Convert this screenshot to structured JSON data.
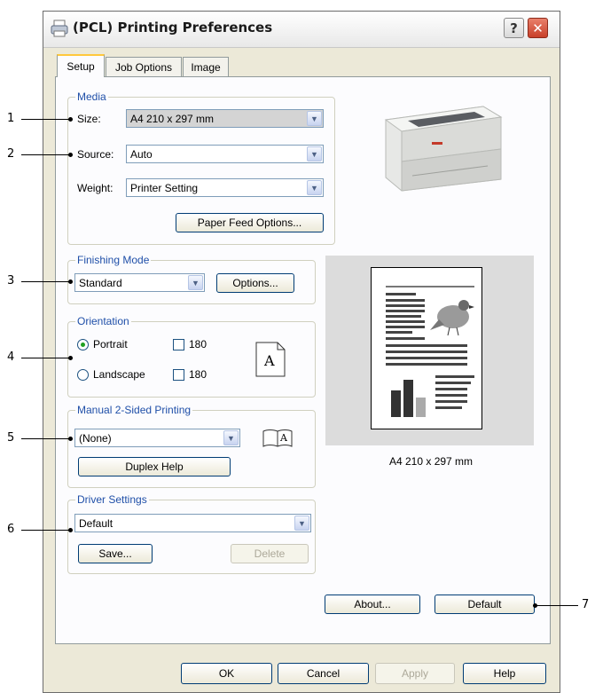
{
  "window": {
    "title": "(PCL) Printing Preferences",
    "help_glyph": "?",
    "close_glyph": "✕"
  },
  "tabs": [
    {
      "label": "Setup",
      "active": true
    },
    {
      "label": "Job Options",
      "active": false
    },
    {
      "label": "Image",
      "active": false
    }
  ],
  "media": {
    "legend": "Media",
    "size_label": "Size:",
    "size_value": "A4 210 x 297 mm",
    "source_label": "Source:",
    "source_value": "Auto",
    "weight_label": "Weight:",
    "weight_value": "Printer Setting",
    "paper_feed_button": "Paper Feed Options..."
  },
  "finishing": {
    "legend": "Finishing Mode",
    "value": "Standard",
    "options_button": "Options..."
  },
  "orientation": {
    "legend": "Orientation",
    "portrait_label": "Portrait",
    "portrait_rotate": "180",
    "landscape_label": "Landscape",
    "landscape_rotate": "180",
    "selected": "Portrait",
    "icon_letter": "A"
  },
  "duplex": {
    "legend": "Manual 2-Sided Printing",
    "value": "(None)",
    "help_button": "Duplex Help",
    "icon_letter": "A"
  },
  "driver_settings": {
    "legend": "Driver Settings",
    "value": "Default",
    "save_button": "Save...",
    "delete_button": "Delete"
  },
  "preview": {
    "caption": "A4 210 x 297 mm"
  },
  "panel_buttons": {
    "about": "About...",
    "default": "Default"
  },
  "dialog_buttons": {
    "ok": "OK",
    "cancel": "Cancel",
    "apply": "Apply",
    "help": "Help"
  },
  "callouts": [
    "1",
    "2",
    "3",
    "4",
    "5",
    "6",
    "7"
  ],
  "colors": {
    "legend_blue": "#1f4fa8",
    "dialog_bg": "#ece9d8",
    "panel_bg": "#fcfcfe",
    "close_red": "#c8402a",
    "tab_highlight": "#ffc83c"
  },
  "icons": [
    "printer-icon",
    "help-icon",
    "close-icon",
    "dropdown-arrow-icon",
    "portrait-page-icon",
    "booklet-icon",
    "printer-image",
    "preview-page"
  ]
}
